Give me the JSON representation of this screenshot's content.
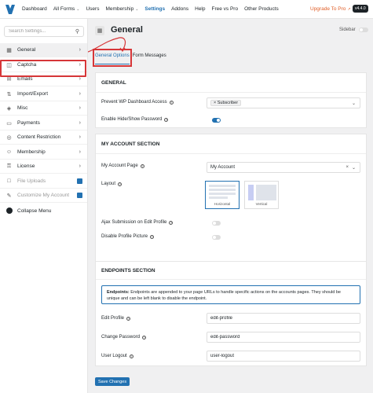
{
  "topnav": {
    "items": [
      "Dashboard",
      "All Forms",
      "Users",
      "Membership",
      "Settings",
      "Addons",
      "Help",
      "Free vs Pro",
      "Other Products"
    ],
    "upgrade": "Upgrade To Pro",
    "version": "v4.4.0"
  },
  "sidebar": {
    "search_placeholder": "Search Settings...",
    "items": [
      {
        "label": "General",
        "icon": "grid-icon"
      },
      {
        "label": "Captcha",
        "icon": "captcha-icon"
      },
      {
        "label": "Emails",
        "icon": "email-icon"
      },
      {
        "label": "Import/Export",
        "icon": "import-icon"
      },
      {
        "label": "Misc",
        "icon": "misc-icon"
      },
      {
        "label": "Payments",
        "icon": "card-icon"
      },
      {
        "label": "Content Restriction",
        "icon": "restriction-icon"
      },
      {
        "label": "Membership",
        "icon": "membership-icon"
      },
      {
        "label": "License",
        "icon": "license-icon"
      },
      {
        "label": "File Uploads",
        "icon": "file-icon"
      },
      {
        "label": "Customize My Account",
        "icon": "customize-icon"
      },
      {
        "label": "Collapse Menu",
        "icon": "collapse-icon"
      }
    ]
  },
  "header": {
    "title": "General",
    "sidebar_toggle_label": "Sidebar"
  },
  "tabs": [
    "General Options",
    "Form Messages"
  ],
  "general_section": {
    "title": "GENERAL",
    "prevent_access_label": "Prevent WP Dashboard Access",
    "prevent_access_value": "Subscriber",
    "hide_show_password_label": "Enable Hide/Show Password"
  },
  "account_section": {
    "title": "MY ACCOUNT SECTION",
    "my_account_page_label": "My Account Page",
    "my_account_page_value": "My Account",
    "layout_label": "Layout",
    "layout_options": [
      "Horizontal",
      "Vertical"
    ],
    "ajax_label": "Ajax Submission on Edit Profile",
    "disable_picture_label": "Disable Profile Picture"
  },
  "endpoints_section": {
    "title": "ENDPOINTS SECTION",
    "notice_bold": "Endpoints:",
    "notice_text": " Endpoints are appended to your page URLs to handle specific actions on the accounts pages. They should be unique and can be left blank to disable the endpoint.",
    "edit_profile_label": "Edit Profile",
    "edit_profile_value": "edit-profile",
    "change_password_label": "Change Password",
    "change_password_value": "edit-password",
    "user_logout_label": "User Logout",
    "user_logout_value": "user-logout"
  },
  "save_label": "Save Changes",
  "colors": {
    "accent": "#2271b1",
    "highlight": "#d63638",
    "upgrade": "#e05d26"
  }
}
